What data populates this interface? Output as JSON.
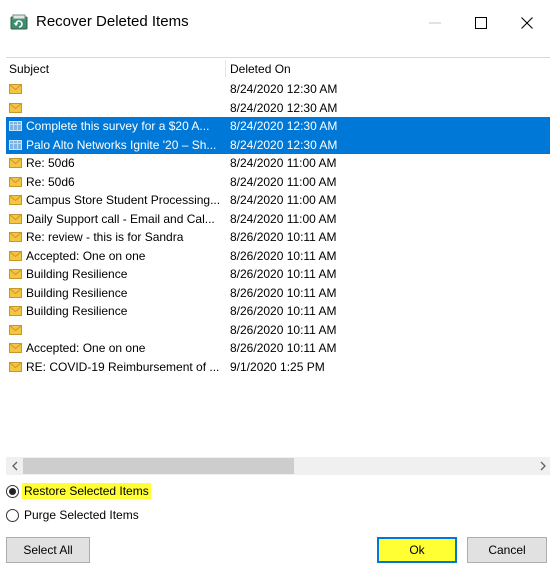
{
  "window": {
    "title": "Recover Deleted Items",
    "icon": "recover-items-icon",
    "controls": {
      "minimize": "minimize-icon",
      "maximize": "maximize-icon",
      "close": "close-icon"
    }
  },
  "list": {
    "columns": {
      "subject": "Subject",
      "deleted_on": "Deleted On"
    },
    "rows": [
      {
        "subject": "",
        "deleted": "8/24/2020 12:30 AM",
        "selected": false,
        "icon": "envelope"
      },
      {
        "subject": "",
        "deleted": "8/24/2020 12:30 AM",
        "selected": false,
        "icon": "envelope"
      },
      {
        "subject": "Complete this survey for a $20 A...",
        "deleted": "8/24/2020 12:30 AM",
        "selected": true,
        "icon": "meeting"
      },
      {
        "subject": "Palo Alto Networks Ignite '20 – Sh...",
        "deleted": "8/24/2020 12:30 AM",
        "selected": true,
        "icon": "meeting"
      },
      {
        "subject": "Re: 50d6",
        "deleted": "8/24/2020 11:00 AM",
        "selected": false,
        "icon": "envelope"
      },
      {
        "subject": "Re: 50d6",
        "deleted": "8/24/2020 11:00 AM",
        "selected": false,
        "icon": "envelope"
      },
      {
        "subject": "Campus Store Student Processing...",
        "deleted": "8/24/2020 11:00 AM",
        "selected": false,
        "icon": "envelope"
      },
      {
        "subject": "Daily Support call - Email and Cal...",
        "deleted": "8/24/2020 11:00 AM",
        "selected": false,
        "icon": "envelope"
      },
      {
        "subject": "Re: review - this is for Sandra",
        "deleted": "8/26/2020 10:11 AM",
        "selected": false,
        "icon": "envelope"
      },
      {
        "subject": "Accepted: One on one",
        "deleted": "8/26/2020 10:11 AM",
        "selected": false,
        "icon": "envelope"
      },
      {
        "subject": "Building Resilience",
        "deleted": "8/26/2020 10:11 AM",
        "selected": false,
        "icon": "envelope"
      },
      {
        "subject": "Building Resilience",
        "deleted": "8/26/2020 10:11 AM",
        "selected": false,
        "icon": "envelope"
      },
      {
        "subject": "Building Resilience",
        "deleted": "8/26/2020 10:11 AM",
        "selected": false,
        "icon": "envelope"
      },
      {
        "subject": "",
        "deleted": "8/26/2020 10:11 AM",
        "selected": false,
        "icon": "envelope"
      },
      {
        "subject": "Accepted: One on one",
        "deleted": "8/26/2020 10:11 AM",
        "selected": false,
        "icon": "envelope"
      },
      {
        "subject": "RE: COVID-19 Reimbursement of ...",
        "deleted": "9/1/2020 1:25 PM",
        "selected": false,
        "icon": "envelope"
      }
    ]
  },
  "scrollbar": {
    "left_arrow": "<",
    "right_arrow": ">"
  },
  "options": {
    "restore_label": "Restore Selected Items",
    "restore_checked": true,
    "purge_label": "Purge Selected Items",
    "purge_checked": false
  },
  "buttons": {
    "select_all": "Select All",
    "ok": "Ok",
    "cancel": "Cancel"
  },
  "colors": {
    "selection": "#0078d7",
    "highlight": "#ffff33",
    "envelope": "#f5c542"
  }
}
